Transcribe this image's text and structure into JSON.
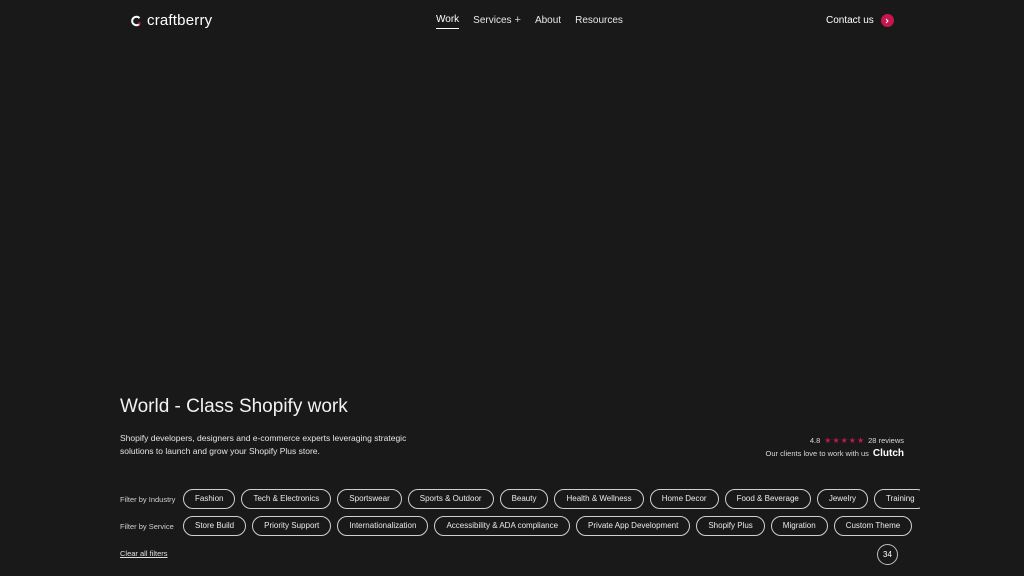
{
  "header": {
    "logo_text": "craftberry",
    "nav": [
      {
        "label": "Work",
        "active": true
      },
      {
        "label": "Services",
        "has_plus": true
      },
      {
        "label": "About"
      },
      {
        "label": "Resources"
      }
    ],
    "contact_label": "Contact us"
  },
  "hero": {
    "title": "World - Class Shopify work",
    "description": "Shopify developers, designers and e-commerce experts leveraging strategic solutions to launch and grow your Shopify Plus store."
  },
  "rating": {
    "score": "4.8",
    "stars": 5,
    "reviews": "28 reviews",
    "tagline": "Our clients love to work with us",
    "brand": "Clutch"
  },
  "filters": {
    "industry_label": "Filter by Industry",
    "industry": [
      "Fashion",
      "Tech & Electronics",
      "Sportswear",
      "Sports & Outdoor",
      "Beauty",
      "Health & Wellness",
      "Home Decor",
      "Food & Beverage",
      "Jewelry",
      "Training"
    ],
    "service_label": "Filter by Service",
    "service": [
      "Store Build",
      "Priority Support",
      "Internationalization",
      "Accessibility & ADA compliance",
      "Private App Development",
      "Shopify Plus",
      "Migration",
      "Custom Theme"
    ],
    "clear_label": "Clear all filters",
    "count": "34"
  },
  "colors": {
    "background": "#1a1919",
    "accent": "#c4174f"
  }
}
